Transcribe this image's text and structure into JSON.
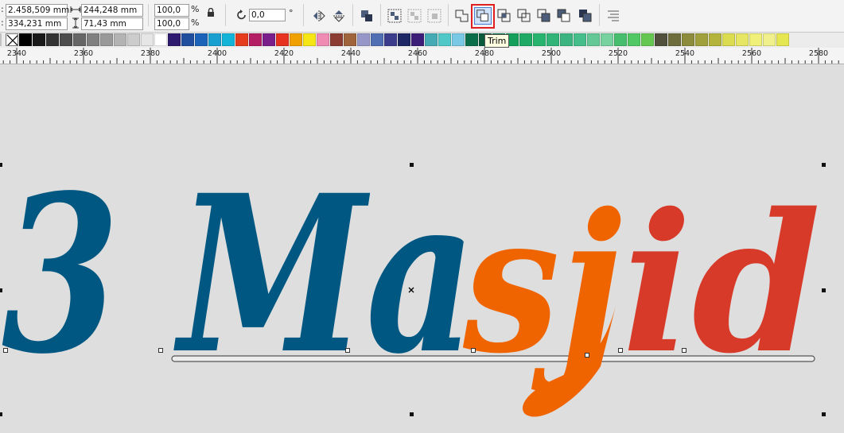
{
  "toolbar": {
    "x_position": "2.458,509 mm",
    "y_position": "334,231 mm",
    "width": "244,248 mm",
    "height": "71,43 mm",
    "scale_x": "100,0",
    "scale_y": "100,0",
    "percent_symbol": "%",
    "rotation": "0,0",
    "degree_symbol": "°",
    "tooltip": "Trim"
  },
  "palette": {
    "colors": [
      "#ffffff",
      "#000000",
      "#1a1a1a",
      "#333333",
      "#4d4d4d",
      "#666666",
      "#808080",
      "#999999",
      "#b3b3b3",
      "#cccccc",
      "#e6e6e6",
      "#ffffff",
      "#2e1b70",
      "#1f4e9e",
      "#1a63b8",
      "#1aa0d0",
      "#14b4d8",
      "#e63c1e",
      "#b41e64",
      "#7a1e8c",
      "#e6321e",
      "#f0a000",
      "#f5e614",
      "#f08cb4",
      "#8c3c32",
      "#a0643c",
      "#9696c8",
      "#506eb4",
      "#3c3c8c",
      "#1e2864",
      "#3c1e78",
      "#46aab4",
      "#50c8c8",
      "#78c8e6",
      "#0a6e4b",
      "#0a5a3c",
      "#0a8c50",
      "#14a05a",
      "#1eaa64",
      "#28b46e",
      "#32b478",
      "#3cb482",
      "#46be8c",
      "#64c896",
      "#78d2a0",
      "#46be6e",
      "#50c864",
      "#64c850",
      "#50503c",
      "#6e6e3c",
      "#8c8c3c",
      "#a0a03c",
      "#b4b43c",
      "#dcdc50",
      "#e6e664",
      "#f0f078",
      "#f0f08c",
      "#e6e650"
    ]
  },
  "ruler": {
    "labels": [
      "2340",
      "2360",
      "2380",
      "2400",
      "2420",
      "2440",
      "2460",
      "2480",
      "2500",
      "2520",
      "2540",
      "2560",
      "2580"
    ]
  },
  "canvas": {
    "text_blue": "3 Ma",
    "text_orange": "sj",
    "text_red": "id",
    "color_blue": "#005882",
    "color_orange": "#f06400",
    "color_red": "#d83a2a"
  }
}
